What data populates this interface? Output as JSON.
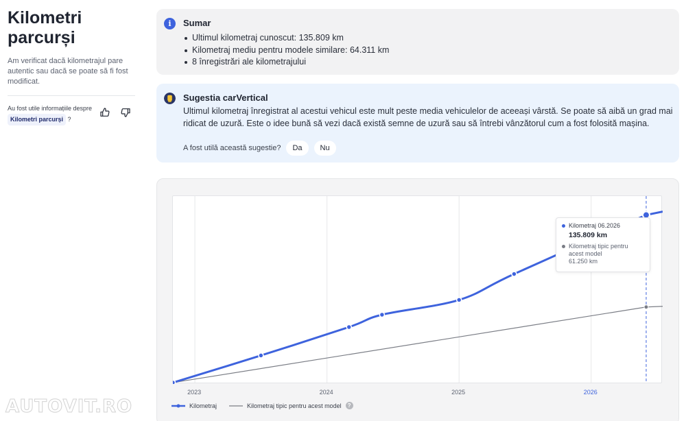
{
  "left": {
    "title": "Kilometri parcurși",
    "description": "Am verificat dacă kilometrajul pare autentic sau dacă se poate să fi fost modificat.",
    "feedback_prefix": "Au fost utile informațiile despre",
    "feedback_tag": "Kilometri parcurși",
    "feedback_suffix": "?"
  },
  "summary": {
    "icon": "info-icon",
    "title": "Sumar",
    "items": [
      "Ultimul kilometraj cunoscut: 135.809 km",
      "Kilometraj mediu pentru modele similare: 64.311 km",
      "8 înregistrări ale kilometrajului"
    ]
  },
  "suggestion": {
    "icon": "lightbulb-icon",
    "title": "Sugestia carVertical",
    "text": "Ultimul kilometraj înregistrat al acestui vehicul este mult peste media vehiculelor de aceeași vârstă. Se poate să aibă un grad mai ridicat de uzură. Este o idee bună să vezi dacă există semne de uzură sau să întrebi vânzătorul cum a fost folosită mașina.",
    "question": "A fost utilă această sugestie?",
    "yes_label": "Da",
    "no_label": "Nu"
  },
  "tooltip": {
    "series1_label": "Kilometraj 06.2026",
    "series1_value": "135.809 km",
    "series2_label": "Kilometraj tipic pentru acest model",
    "series2_value": "61.250 km"
  },
  "legend": {
    "series1": "Kilometraj",
    "series2": "Kilometraj tipic pentru acest model"
  },
  "watermark": "AUTOVIT.RO",
  "colors": {
    "series1": "#3e63dd",
    "series2": "#7a7d85",
    "highlight_tick": "#3e63dd"
  },
  "chart_data": {
    "type": "line",
    "x_ticks": [
      "2023",
      "2024",
      "2025",
      "2026"
    ],
    "highlight_tick": "2026",
    "series": [
      {
        "name": "Kilometraj",
        "points": [
          {
            "x": "2022-11",
            "y": 0
          },
          {
            "x": "2023-07",
            "y": 22000
          },
          {
            "x": "2024-03",
            "y": 45000
          },
          {
            "x": "2024-06",
            "y": 55000
          },
          {
            "x": "2025-01",
            "y": 67000
          },
          {
            "x": "2025-06",
            "y": 88000
          },
          {
            "x": "2026-06",
            "y": 135809
          }
        ]
      },
      {
        "name": "Kilometraj tipic pentru acest model",
        "points": [
          {
            "x": "2022-11",
            "y": 0
          },
          {
            "x": "2026-06",
            "y": 61250
          }
        ]
      }
    ],
    "xlim": [
      "2022-11",
      "2026-07"
    ],
    "ylim": [
      0,
      140000
    ],
    "grid": true,
    "legend": "bottom-left"
  }
}
